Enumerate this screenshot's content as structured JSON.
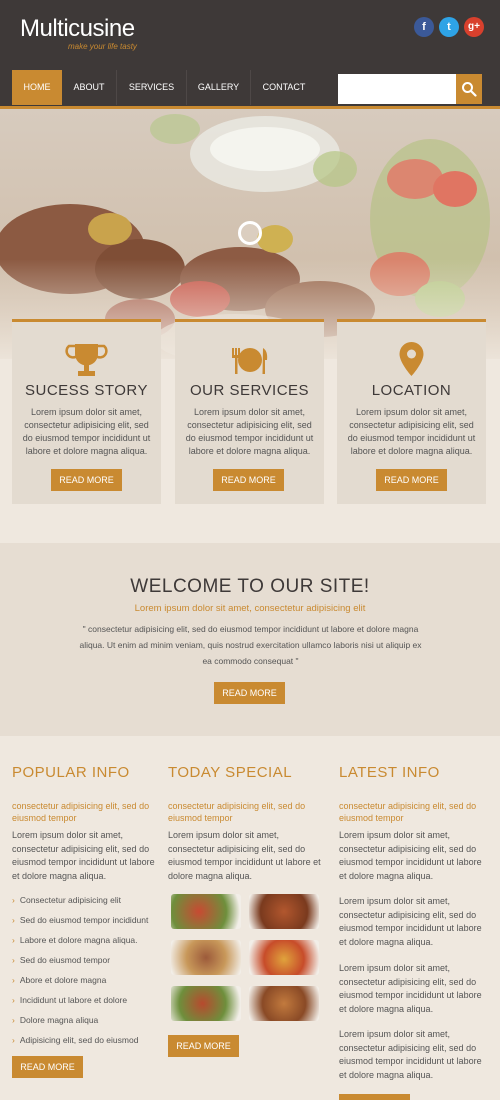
{
  "site": {
    "logo": "Multicusine",
    "tagline": "make your life tasty"
  },
  "social": {
    "facebook": "f",
    "twitter": "t",
    "googleplus": "g+"
  },
  "nav": {
    "items": [
      "HOME",
      "ABOUT",
      "SERVICES",
      "GALLERY",
      "CONTACT"
    ],
    "active": "HOME"
  },
  "search": {
    "placeholder": ""
  },
  "features": [
    {
      "title": "SUCESS STORY",
      "text": "Lorem ipsum dolor sit amet, consectetur adipisicing elit, sed do eiusmod tempor incididunt ut labore et dolore magna aliqua.",
      "button": "READ MORE",
      "icon": "trophy-icon"
    },
    {
      "title": "OUR SERVICES",
      "text": "Lorem ipsum dolor sit amet, consectetur adipisicing elit, sed do eiusmod tempor incididunt ut labore et dolore magna aliqua.",
      "button": "READ MORE",
      "icon": "plate-cutlery-icon"
    },
    {
      "title": "LOCATION",
      "text": "Lorem ipsum dolor sit amet, consectetur adipisicing elit, sed do eiusmod tempor incididunt ut labore et dolore magna aliqua.",
      "button": "READ MORE",
      "icon": "map-pin-icon"
    }
  ],
  "welcome": {
    "title": "WELCOME TO OUR SITE!",
    "subtitle": "Lorem ipsum dolor sit amet, consectetur adipisicing elit",
    "text": "\" consectetur adipisicing elit, sed do eiusmod tempor incididunt ut labore et dolore magna aliqua. Ut enim ad minim veniam, quis nostrud exercitation ullamco laboris nisi ut aliquip ex ea commodo consequat \"",
    "button": "READ MORE"
  },
  "popular": {
    "title": "POPULAR INFO",
    "subtitle": "consectetur adipisicing elit, sed do eiusmod tempor",
    "text": "Lorem ipsum dolor sit amet, consectetur adipisicing elit, sed do eiusmod tempor incididunt ut labore et dolore magna aliqua.",
    "list": [
      "Consectetur adipisicing elit",
      "Sed do eiusmod tempor incididunt",
      "Labore et dolore magna aliqua.",
      "Sed do eiusmod tempor",
      "Abore et dolore magna",
      "Incididunt ut labore et dolore",
      "Dolore magna aliqua",
      "Adipisicing elit, sed do eiusmod"
    ],
    "button": "READ MORE"
  },
  "special": {
    "title": "TODAY SPECIAL",
    "subtitle": "consectetur adipisicing elit, sed do eiusmod tempor",
    "text": "Lorem ipsum dolor sit amet, consectetur adipisicing elit, sed do eiusmod tempor incididunt ut labore et dolore magna aliqua.",
    "button": "READ MORE"
  },
  "latest": {
    "title": "LATEST INFO",
    "subtitle": "consectetur adipisicing elit, sed do eiusmod tempor",
    "paragraphs": [
      "Lorem ipsum dolor sit amet, consectetur adipisicing elit, sed do eiusmod tempor incididunt ut labore et dolore magna aliqua.",
      "Lorem ipsum dolor sit amet, consectetur adipisicing elit, sed do eiusmod tempor incididunt ut labore et dolore magna aliqua.",
      "Lorem ipsum dolor sit amet, consectetur adipisicing elit, sed do eiusmod tempor incididunt ut labore et dolore magna aliqua.",
      "Lorem ipsum dolor sit amet, consectetur adipisicing elit, sed do eiusmod tempor incididunt ut labore et dolore magna aliqua."
    ]
  },
  "colors": {
    "accent": "#c98a31",
    "dark": "#3e3938",
    "background": "#efe8df"
  }
}
